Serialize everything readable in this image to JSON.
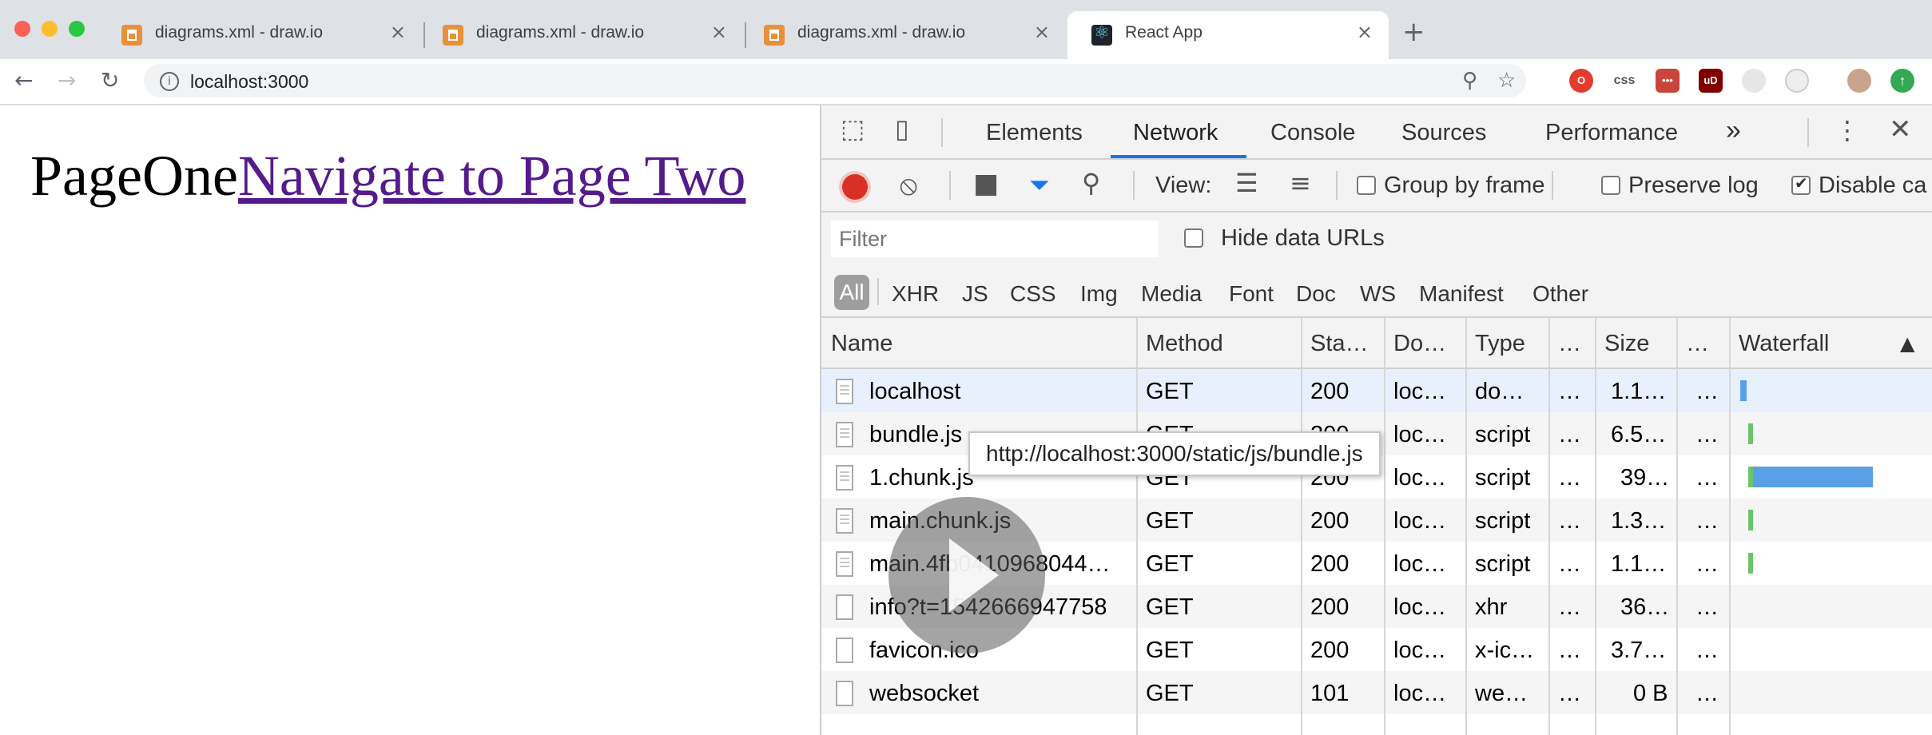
{
  "browser": {
    "tabs": [
      {
        "title": "diagrams.xml - draw.io",
        "icon": "drawio-icon"
      },
      {
        "title": "diagrams.xml - draw.io",
        "icon": "drawio-icon"
      },
      {
        "title": "diagrams.xml - draw.io",
        "icon": "drawio-icon"
      },
      {
        "title": "React App",
        "icon": "react-icon",
        "active": true
      }
    ],
    "address": "localhost:3000",
    "close_glyph": "×",
    "new_tab_glyph": "+",
    "ext_css": "css",
    "ext_ublock": "uD"
  },
  "page": {
    "text": "PageOne",
    "link": "Navigate to Page Two"
  },
  "devtools": {
    "tabs": [
      "Elements",
      "Network",
      "Console",
      "Sources",
      "Performance"
    ],
    "active_tab": "Network",
    "more": "»",
    "view_label": "View:",
    "group_by_frame": "Group by frame",
    "preserve_log": "Preserve log",
    "disable_cache": "Disable ca",
    "disable_cache_checked": true,
    "filter_placeholder": "Filter",
    "hide_data_urls": "Hide data URLs",
    "types": [
      "All",
      "XHR",
      "JS",
      "CSS",
      "Img",
      "Media",
      "Font",
      "Doc",
      "WS",
      "Manifest",
      "Other"
    ],
    "columns": [
      "Name",
      "Method",
      "Sta…",
      "Do…",
      "Type",
      "…",
      "Size",
      "…",
      "Waterfall"
    ],
    "sort_glyph": "▲",
    "rows": [
      {
        "name": "localhost",
        "method": "GET",
        "status": "200",
        "domain": "loc…",
        "type": "do…",
        "c6": "…",
        "size": "1.1…",
        "c8": "…"
      },
      {
        "name": "bundle.js",
        "method": "GET",
        "status": "200",
        "domain": "loc…",
        "type": "script",
        "c6": "…",
        "size": "6.5…",
        "c8": "…"
      },
      {
        "name": "1.chunk.js",
        "method": "GET",
        "status": "200",
        "domain": "loc…",
        "type": "script",
        "c6": "…",
        "size": "39…",
        "c8": "…"
      },
      {
        "name": "main.chunk.js",
        "method": "GET",
        "status": "200",
        "domain": "loc…",
        "type": "script",
        "c6": "…",
        "size": "1.3…",
        "c8": "…"
      },
      {
        "name": "main.4fb0410968044…",
        "method": "GET",
        "status": "200",
        "domain": "loc…",
        "type": "script",
        "c6": "…",
        "size": "1.1…",
        "c8": "…"
      },
      {
        "name": "info?t=1542666947758",
        "method": "GET",
        "status": "200",
        "domain": "loc…",
        "type": "xhr",
        "c6": "…",
        "size": "36…",
        "c8": "…"
      },
      {
        "name": "favicon.ico",
        "method": "GET",
        "status": "200",
        "domain": "loc…",
        "type": "x-ic…",
        "c6": "…",
        "size": "3.7…",
        "c8": "…"
      },
      {
        "name": "websocket",
        "method": "GET",
        "status": "101",
        "domain": "loc…",
        "type": "we…",
        "c6": "…",
        "size": "0 B",
        "c8": "…"
      }
    ],
    "tooltip": "http://localhost:3000/static/js/bundle.js"
  },
  "colors": {
    "record": "#d93025",
    "link": "#551a8b",
    "tab_underline": "#1a73e8",
    "waterfall": "#5aa0e6",
    "selected_row": "#e8f0fe"
  }
}
